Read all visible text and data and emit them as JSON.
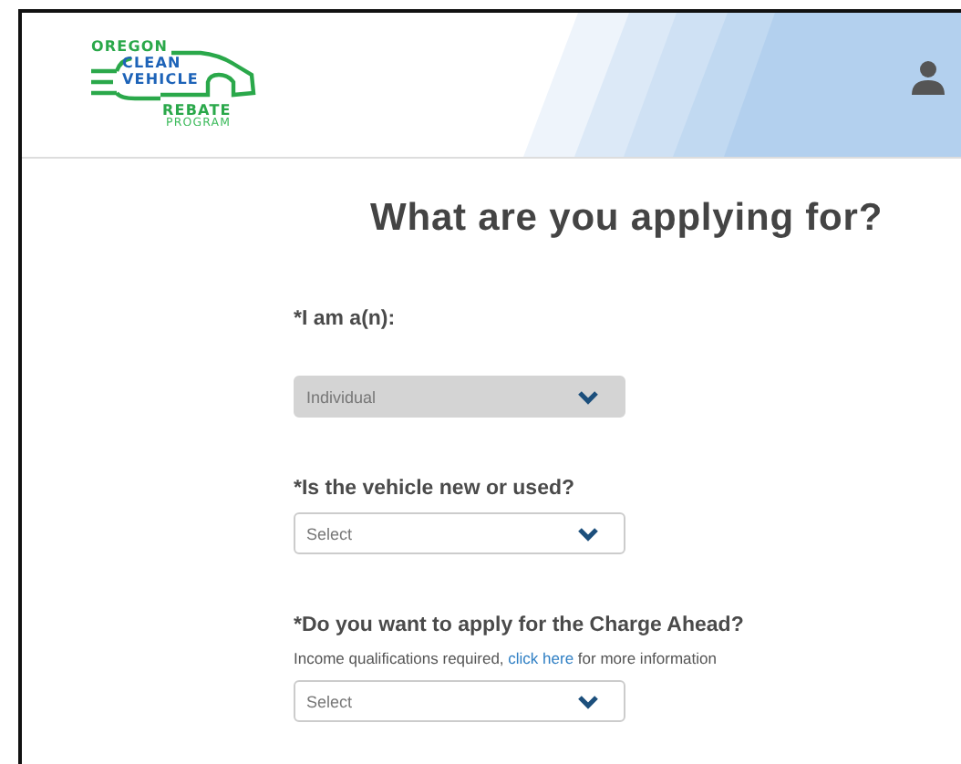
{
  "logo": {
    "lines": [
      "OREGON",
      "CLEAN",
      "VEHICLE",
      "REBATE",
      "PROGRAM"
    ]
  },
  "heading": "What are you applying for?",
  "fields": [
    {
      "label": "*I am a(n):",
      "value": "Individual",
      "disabled": true
    },
    {
      "label": "*Is the vehicle new or used?",
      "value": "Select",
      "disabled": false
    },
    {
      "label": "*Do you want to apply for the Charge Ahead?",
      "help": {
        "before": "Income qualifications required, ",
        "link": "click here",
        "after": " for more information"
      },
      "value": "Select",
      "disabled": false
    }
  ]
}
